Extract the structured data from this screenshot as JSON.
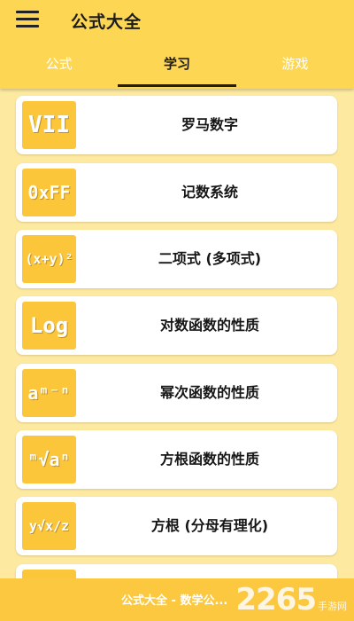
{
  "app": {
    "title": "公式大全"
  },
  "tabs": [
    {
      "label": "公式",
      "active": false
    },
    {
      "label": "学习",
      "active": true
    },
    {
      "label": "游戏",
      "active": false
    }
  ],
  "items": [
    {
      "label": "罗马数字",
      "icon_text": "VII"
    },
    {
      "label": "记数系统",
      "icon_text": "0xFF"
    },
    {
      "label": "二项式 (多项式)",
      "icon_text": "(x+y)²"
    },
    {
      "label": "对数函数的性质",
      "icon_text": "Log"
    },
    {
      "label": "幂次函数的性质",
      "icon_text": "aᵐ⁻ⁿ"
    },
    {
      "label": "方根函数的性质",
      "icon_text": "ᵐ√aⁿ"
    },
    {
      "label": "方根 (分母有理化)",
      "icon_text": "y√x/z"
    }
  ],
  "footer": {
    "text": "公式大全 - 数学公..."
  },
  "watermark": {
    "main": "2265",
    "sub": "手游网"
  },
  "colors": {
    "appbar": "#fdd653",
    "icon_bg": "#fcc63b",
    "background": "#fde9a0",
    "footer": "#fcc83f"
  }
}
